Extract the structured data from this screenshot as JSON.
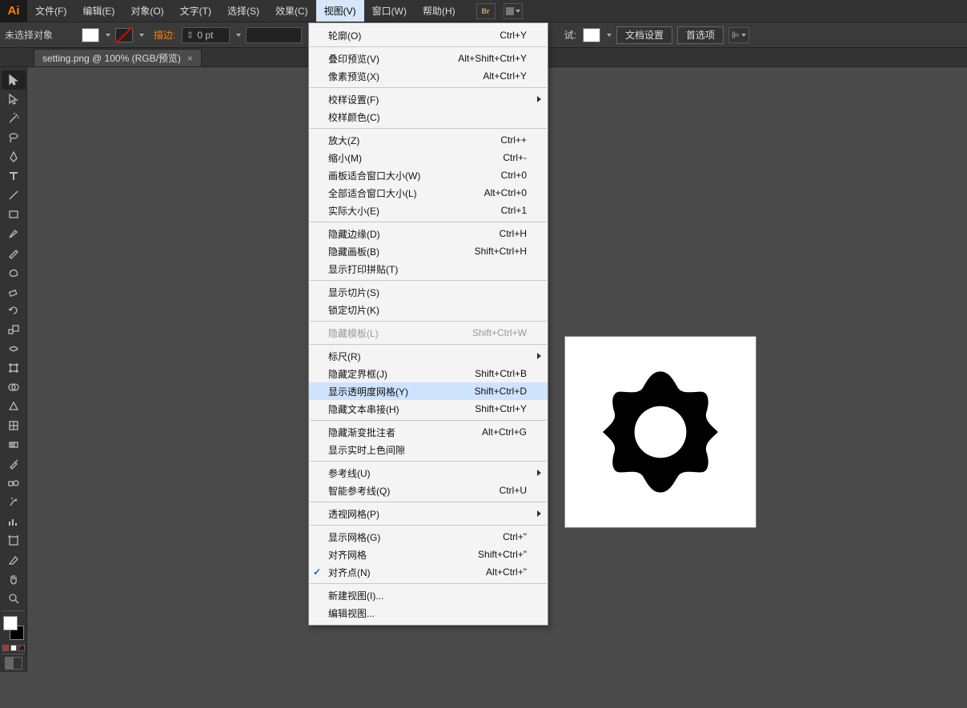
{
  "menubar": {
    "items": [
      "文件(F)",
      "编辑(E)",
      "对象(O)",
      "文字(T)",
      "选择(S)",
      "效果(C)",
      "视图(V)",
      "窗口(W)",
      "帮助(H)"
    ],
    "active_index": 6
  },
  "ctrlbar": {
    "selection_label": "未选择对象",
    "stroke_label": "描边:",
    "stroke_value": "0 pt",
    "style_label": "试:",
    "doc_setup": "文档设置",
    "prefs": "首选项"
  },
  "tab": {
    "label": "setting.png @ 100% (RGB/预览)",
    "close": "×"
  },
  "dropdown": [
    {
      "type": "item",
      "label": "轮廓(O)",
      "shortcut": "Ctrl+Y"
    },
    {
      "type": "sep"
    },
    {
      "type": "item",
      "label": "叠印预览(V)",
      "shortcut": "Alt+Shift+Ctrl+Y"
    },
    {
      "type": "item",
      "label": "像素预览(X)",
      "shortcut": "Alt+Ctrl+Y"
    },
    {
      "type": "sep"
    },
    {
      "type": "item",
      "label": "校样设置(F)",
      "submenu": true
    },
    {
      "type": "item",
      "label": "校样颜色(C)"
    },
    {
      "type": "sep"
    },
    {
      "type": "item",
      "label": "放大(Z)",
      "shortcut": "Ctrl++"
    },
    {
      "type": "item",
      "label": "缩小(M)",
      "shortcut": "Ctrl+-"
    },
    {
      "type": "item",
      "label": "画板适合窗口大小(W)",
      "shortcut": "Ctrl+0"
    },
    {
      "type": "item",
      "label": "全部适合窗口大小(L)",
      "shortcut": "Alt+Ctrl+0"
    },
    {
      "type": "item",
      "label": "实际大小(E)",
      "shortcut": "Ctrl+1"
    },
    {
      "type": "sep"
    },
    {
      "type": "item",
      "label": "隐藏边缘(D)",
      "shortcut": "Ctrl+H"
    },
    {
      "type": "item",
      "label": "隐藏画板(B)",
      "shortcut": "Shift+Ctrl+H"
    },
    {
      "type": "item",
      "label": "显示打印拼贴(T)"
    },
    {
      "type": "sep"
    },
    {
      "type": "item",
      "label": "显示切片(S)"
    },
    {
      "type": "item",
      "label": "锁定切片(K)"
    },
    {
      "type": "sep"
    },
    {
      "type": "item",
      "label": "隐藏模板(L)",
      "shortcut": "Shift+Ctrl+W",
      "disabled": true
    },
    {
      "type": "sep"
    },
    {
      "type": "item",
      "label": "标尺(R)",
      "submenu": true
    },
    {
      "type": "item",
      "label": "隐藏定界框(J)",
      "shortcut": "Shift+Ctrl+B"
    },
    {
      "type": "item",
      "label": "显示透明度网格(Y)",
      "shortcut": "Shift+Ctrl+D",
      "highlighted": true
    },
    {
      "type": "item",
      "label": "隐藏文本串接(H)",
      "shortcut": "Shift+Ctrl+Y"
    },
    {
      "type": "sep"
    },
    {
      "type": "item",
      "label": "隐藏渐变批注者",
      "shortcut": "Alt+Ctrl+G"
    },
    {
      "type": "item",
      "label": "显示实时上色间隙"
    },
    {
      "type": "sep"
    },
    {
      "type": "item",
      "label": "参考线(U)",
      "submenu": true
    },
    {
      "type": "item",
      "label": "智能参考线(Q)",
      "shortcut": "Ctrl+U"
    },
    {
      "type": "sep"
    },
    {
      "type": "item",
      "label": "透视网格(P)",
      "submenu": true
    },
    {
      "type": "sep"
    },
    {
      "type": "item",
      "label": "显示网格(G)",
      "shortcut": "Ctrl+\""
    },
    {
      "type": "item",
      "label": "对齐网格",
      "shortcut": "Shift+Ctrl+\""
    },
    {
      "type": "item",
      "label": "对齐点(N)",
      "shortcut": "Alt+Ctrl+\"",
      "checked": true
    },
    {
      "type": "sep"
    },
    {
      "type": "item",
      "label": "新建视图(I)..."
    },
    {
      "type": "item",
      "label": "编辑视图..."
    }
  ],
  "tools": [
    "selection",
    "direct-selection",
    "magic-wand",
    "lasso",
    "pen",
    "type",
    "line",
    "rectangle",
    "paintbrush",
    "pencil",
    "blob-brush",
    "eraser",
    "rotate",
    "scale",
    "width",
    "free-transform",
    "shape-builder",
    "perspective",
    "mesh",
    "gradient",
    "eyedropper",
    "blend",
    "symbol-sprayer",
    "column-graph",
    "artboard",
    "slice",
    "hand",
    "zoom"
  ]
}
